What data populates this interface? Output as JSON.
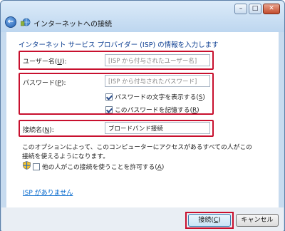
{
  "window": {
    "title": "インターネットへの接続",
    "minimize": "–",
    "maximize": "□",
    "close": "✕",
    "back": "←"
  },
  "heading": "インターネット サービス プロバイダー (ISP) の情報を入力します",
  "fields": {
    "username": {
      "label_pre": "ユーザー名(",
      "key": "U",
      "label_post": "):",
      "placeholder": "[ISP から付与されたユーザー名]",
      "value": ""
    },
    "password": {
      "label_pre": "パスワード(",
      "key": "P",
      "label_post": "):",
      "placeholder": "[ISP から付与されたパスワード]",
      "value": ""
    },
    "connection": {
      "label_pre": "接続名(",
      "key": "N",
      "label_post": "):",
      "value": "ブロードバンド接続"
    }
  },
  "checkboxes": {
    "show_chars": {
      "label_pre": "パスワードの文字を表示する(",
      "key": "S",
      "label_post": ")",
      "checked": true
    },
    "remember": {
      "label_pre": "このパスワードを記憶する(",
      "key": "R",
      "label_post": ")",
      "checked": true
    },
    "allow_others": {
      "label_pre": "他の人がこの接続を使うことを許可する(",
      "key": "A",
      "label_post": ")",
      "checked": false
    }
  },
  "note": "このオプションによって、このコンピューターにアクセスがあるすべての人がこの接続を使えるようになります。",
  "link": "ISP がありません",
  "buttons": {
    "connect": {
      "label_pre": "接続(",
      "key": "C",
      "label_post": ")"
    },
    "cancel": "キャンセル"
  },
  "colors": {
    "highlight": "#c8102e",
    "link": "#0066cc",
    "heading": "#0b3d91"
  }
}
